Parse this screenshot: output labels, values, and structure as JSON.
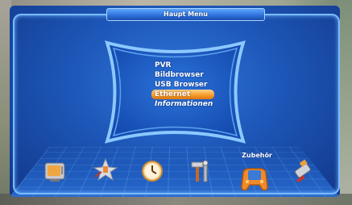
{
  "header": {
    "title": "Haupt Menu"
  },
  "menu": {
    "items": [
      {
        "label": "PVR"
      },
      {
        "label": "Bildbrowser"
      },
      {
        "label": "USB Browser"
      },
      {
        "label": "Ethernet",
        "selected": true
      },
      {
        "label": "Informationen"
      }
    ]
  },
  "icon_bar": {
    "focused_label": "Zubehör",
    "icons": [
      {
        "name": "tv-icon"
      },
      {
        "name": "satellite-icon"
      },
      {
        "name": "clock-icon"
      },
      {
        "name": "tools-icon"
      },
      {
        "name": "gamepad-icon",
        "focused": true
      },
      {
        "name": "usb-stick-icon"
      }
    ]
  },
  "colors": {
    "background": "#1d57b8",
    "frame": "#79bbff",
    "selection": "#f59a2a",
    "text": "#ffffff"
  }
}
